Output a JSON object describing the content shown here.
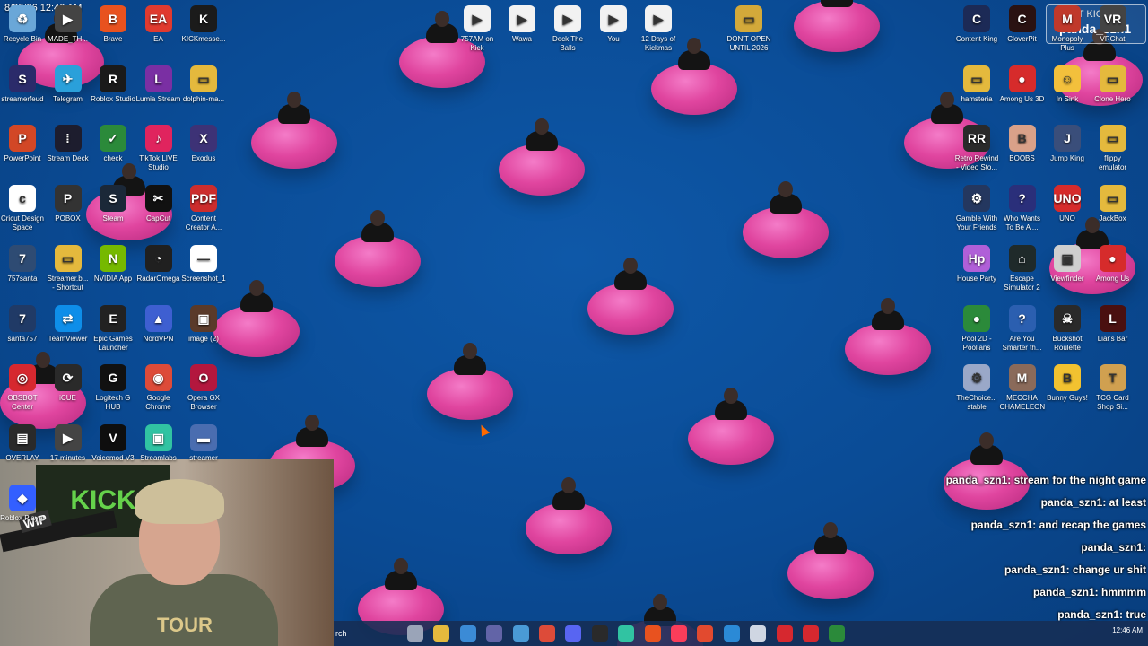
{
  "clock": "8/30/26 12:46 AM",
  "desktop_icons_left": [
    {
      "label": "Recycle Bin",
      "color": "#6aa7d8",
      "glyph": "♻"
    },
    {
      "label": "MADE_TH...",
      "color": "#444444",
      "glyph": "▶"
    },
    {
      "label": "Brave",
      "color": "#e8521f",
      "glyph": "B"
    },
    {
      "label": "EA",
      "color": "#e03a2f",
      "glyph": "EA"
    },
    {
      "label": "KICKmesse...",
      "color": "#1b1b1b",
      "glyph": "K"
    },
    {
      "label": "streamerfeud",
      "color": "#2b2b6a",
      "glyph": "S"
    },
    {
      "label": "Telegram",
      "color": "#2aa0da",
      "glyph": "✈"
    },
    {
      "label": "Roblox Studio",
      "color": "#1a1a1a",
      "glyph": "R"
    },
    {
      "label": "Lumia Stream",
      "color": "#7a2fa3",
      "glyph": "L"
    },
    {
      "label": "dolphin-ma...",
      "color": "#e4b93d",
      "glyph": "▭"
    },
    {
      "label": "PowerPoint",
      "color": "#d24726",
      "glyph": "P"
    },
    {
      "label": "Stream Deck",
      "color": "#1d1d2e",
      "glyph": "⁞"
    },
    {
      "label": "check",
      "color": "#2b8a3a",
      "glyph": "✓"
    },
    {
      "label": "TikTok LIVE Studio",
      "color": "#e0245e",
      "glyph": "♪"
    },
    {
      "label": "Exodus",
      "color": "#3d3276",
      "glyph": "X"
    },
    {
      "label": "Cricut Design Space",
      "color": "#ffffff",
      "glyph": "c"
    },
    {
      "label": "POBOX",
      "color": "#333333",
      "glyph": "P"
    },
    {
      "label": "Steam",
      "color": "#1b2838",
      "glyph": "S"
    },
    {
      "label": "CapCut",
      "color": "#111111",
      "glyph": "✂"
    },
    {
      "label": "Content Creator A...",
      "color": "#cc2d2d",
      "glyph": "PDF"
    },
    {
      "label": "757santa",
      "color": "#2e4b73",
      "glyph": "7"
    },
    {
      "label": "Streamer.b... - Shortcut",
      "color": "#e4b93d",
      "glyph": "▭"
    },
    {
      "label": "NVIDIA App",
      "color": "#76b900",
      "glyph": "N"
    },
    {
      "label": "RadarOmega",
      "color": "#202020",
      "glyph": "◔"
    },
    {
      "label": "Screenshot_1",
      "color": "#ffffff",
      "glyph": "—"
    },
    {
      "label": "santa757",
      "color": "#203a66",
      "glyph": "7"
    },
    {
      "label": "TeamViewer",
      "color": "#0e8ee9",
      "glyph": "⇄"
    },
    {
      "label": "Epic Games Launcher",
      "color": "#222222",
      "glyph": "E"
    },
    {
      "label": "NordVPN",
      "color": "#3e5fd1",
      "glyph": "▲"
    },
    {
      "label": "image (2)",
      "color": "#5a3a2a",
      "glyph": "▣"
    },
    {
      "label": "OBSBOT Center",
      "color": "#d6282f",
      "glyph": "◎"
    },
    {
      "label": "iCUE",
      "color": "#2a2a2a",
      "glyph": "⟳"
    },
    {
      "label": "Logitech G HUB",
      "color": "#111111",
      "glyph": "G"
    },
    {
      "label": "Google Chrome",
      "color": "#dd4b39",
      "glyph": "◉"
    },
    {
      "label": "Opera GX Browser",
      "color": "#b3173e",
      "glyph": "O"
    },
    {
      "label": "OVERLAY",
      "color": "#2a2a2a",
      "glyph": "▤"
    },
    {
      "label": "17 minutes",
      "color": "#444444",
      "glyph": "▶"
    },
    {
      "label": "Voicemod V3",
      "color": "#0e0e0e",
      "glyph": "V"
    },
    {
      "label": "Streamlabs",
      "color": "#31c3a2",
      "glyph": "▣"
    },
    {
      "label": "streamer",
      "color": "#4a6db0",
      "glyph": "▬"
    },
    {
      "label": "Roblox Player",
      "color": "#335fff",
      "glyph": "◆"
    }
  ],
  "desktop_icons_top": [
    {
      "label": "757AM on Kick",
      "color": "#f2f2f2",
      "glyph": "▶"
    },
    {
      "label": "Wawa",
      "color": "#f2f2f2",
      "glyph": "▶"
    },
    {
      "label": "Deck The Balls",
      "color": "#f2f2f2",
      "glyph": "▶"
    },
    {
      "label": "You",
      "color": "#f2f2f2",
      "glyph": "▶"
    },
    {
      "label": "12 Days of Kickmas",
      "color": "#f2f2f2",
      "glyph": "▶"
    },
    {
      "label": "DON'T OPEN UNTIL 2026",
      "color": "#d3a93a",
      "glyph": "▭"
    }
  ],
  "desktop_icons_right": [
    {
      "label": "Content King",
      "color": "#1c2a56",
      "glyph": "C"
    },
    {
      "label": "CloverPit",
      "color": "#2a1212",
      "glyph": "C"
    },
    {
      "label": "Monopoly Plus",
      "color": "#c0392b",
      "glyph": "M"
    },
    {
      "label": "VRChat",
      "color": "#444444",
      "glyph": "VR"
    },
    {
      "label": "hamsteria",
      "color": "#e4b93d",
      "glyph": "▭"
    },
    {
      "label": "Among Us 3D",
      "color": "#d62b2b",
      "glyph": "●"
    },
    {
      "label": "In Sink",
      "color": "#f3c03c",
      "glyph": "☺"
    },
    {
      "label": "Clone Hero",
      "color": "#e4b93d",
      "glyph": "▭"
    },
    {
      "label": "Retro Rewind - Video Sto...",
      "color": "#2a2a2a",
      "glyph": "RR"
    },
    {
      "label": "BOOBS",
      "color": "#d9a189",
      "glyph": "B"
    },
    {
      "label": "Jump King",
      "color": "#3a4e7a",
      "glyph": "J"
    },
    {
      "label": "flippy emulator",
      "color": "#e4b93d",
      "glyph": "▭"
    },
    {
      "label": "Gamble With Your Friends",
      "color": "#24375f",
      "glyph": "⚙"
    },
    {
      "label": "Who Wants To Be A ...",
      "color": "#2a2f7a",
      "glyph": "?"
    },
    {
      "label": "UNO",
      "color": "#d62b2b",
      "glyph": "UNO"
    },
    {
      "label": "JackBox",
      "color": "#e4b93d",
      "glyph": "▭"
    },
    {
      "label": "House Party",
      "color": "#b05fd8",
      "glyph": "Hp"
    },
    {
      "label": "Escape Simulator 2",
      "color": "#1f2a2a",
      "glyph": "⌂"
    },
    {
      "label": "Viewfinder",
      "color": "#cfcfcf",
      "glyph": "▣"
    },
    {
      "label": "Among Us",
      "color": "#d62b2b",
      "glyph": "●"
    },
    {
      "label": "Pool 2D - Poolians",
      "color": "#2b8a3a",
      "glyph": "●"
    },
    {
      "label": "Are You Smarter th...",
      "color": "#2b5fb0",
      "glyph": "?"
    },
    {
      "label": "Buckshot Roulette",
      "color": "#2a2a2a",
      "glyph": "☠"
    },
    {
      "label": "Liar's Bar",
      "color": "#4a1010",
      "glyph": "L"
    },
    {
      "label": "TheChoice... stable",
      "color": "#9aa8c8",
      "glyph": "⚙"
    },
    {
      "label": "MECCHA CHAMELEON",
      "color": "#8a6a5a",
      "glyph": "M"
    },
    {
      "label": "Bunny Guys!",
      "color": "#f2c230",
      "glyph": "B"
    },
    {
      "label": "TCG Card Shop Si...",
      "color": "#d0a050",
      "glyph": "T"
    }
  ],
  "overlay": {
    "title": "LAST KICK",
    "user": "panda_szn1"
  },
  "chat": [
    {
      "text": "panda_szn1: stream for the night game"
    },
    {
      "text": "panda_szn1: at least"
    },
    {
      "text": "panda_szn1: and recap the games"
    },
    {
      "text": "panda_szn1:"
    },
    {
      "text": "panda_szn1: change ur shit"
    },
    {
      "text": "panda_szn1: hmmmm"
    },
    {
      "text": "panda_szn1: true"
    }
  ],
  "webcam": {
    "banner": "KICK",
    "shirt": "TOUR",
    "wip": "WIP"
  },
  "taskbar": {
    "search_label": "rch",
    "apps": [
      {
        "name": "task-view-icon",
        "color": "#9aa4b8"
      },
      {
        "name": "file-explorer-icon",
        "color": "#e4b93d"
      },
      {
        "name": "copilot-icon",
        "color": "#3b8bd6"
      },
      {
        "name": "teams-icon",
        "color": "#6264a7"
      },
      {
        "name": "store-icon",
        "color": "#4a9ad6"
      },
      {
        "name": "chrome-icon",
        "color": "#dd4b39"
      },
      {
        "name": "discord-icon",
        "color": "#5865f2"
      },
      {
        "name": "obs-icon",
        "color": "#2a2a2a"
      },
      {
        "name": "streamlabs-icon",
        "color": "#31c3a2"
      },
      {
        "name": "brave-icon",
        "color": "#e8521f"
      },
      {
        "name": "music-icon",
        "color": "#fa3d5a"
      },
      {
        "name": "git-icon",
        "color": "#e24a2f"
      },
      {
        "name": "help-icon",
        "color": "#2b8ad6"
      },
      {
        "name": "window-icon",
        "color": "#cfd6e2"
      },
      {
        "name": "game-icon",
        "color": "#d6282f"
      },
      {
        "name": "obsbot-icon",
        "color": "#d6282f"
      },
      {
        "name": "xbox-icon",
        "color": "#2b8a3a"
      }
    ],
    "tray_time": "12:46 AM"
  }
}
